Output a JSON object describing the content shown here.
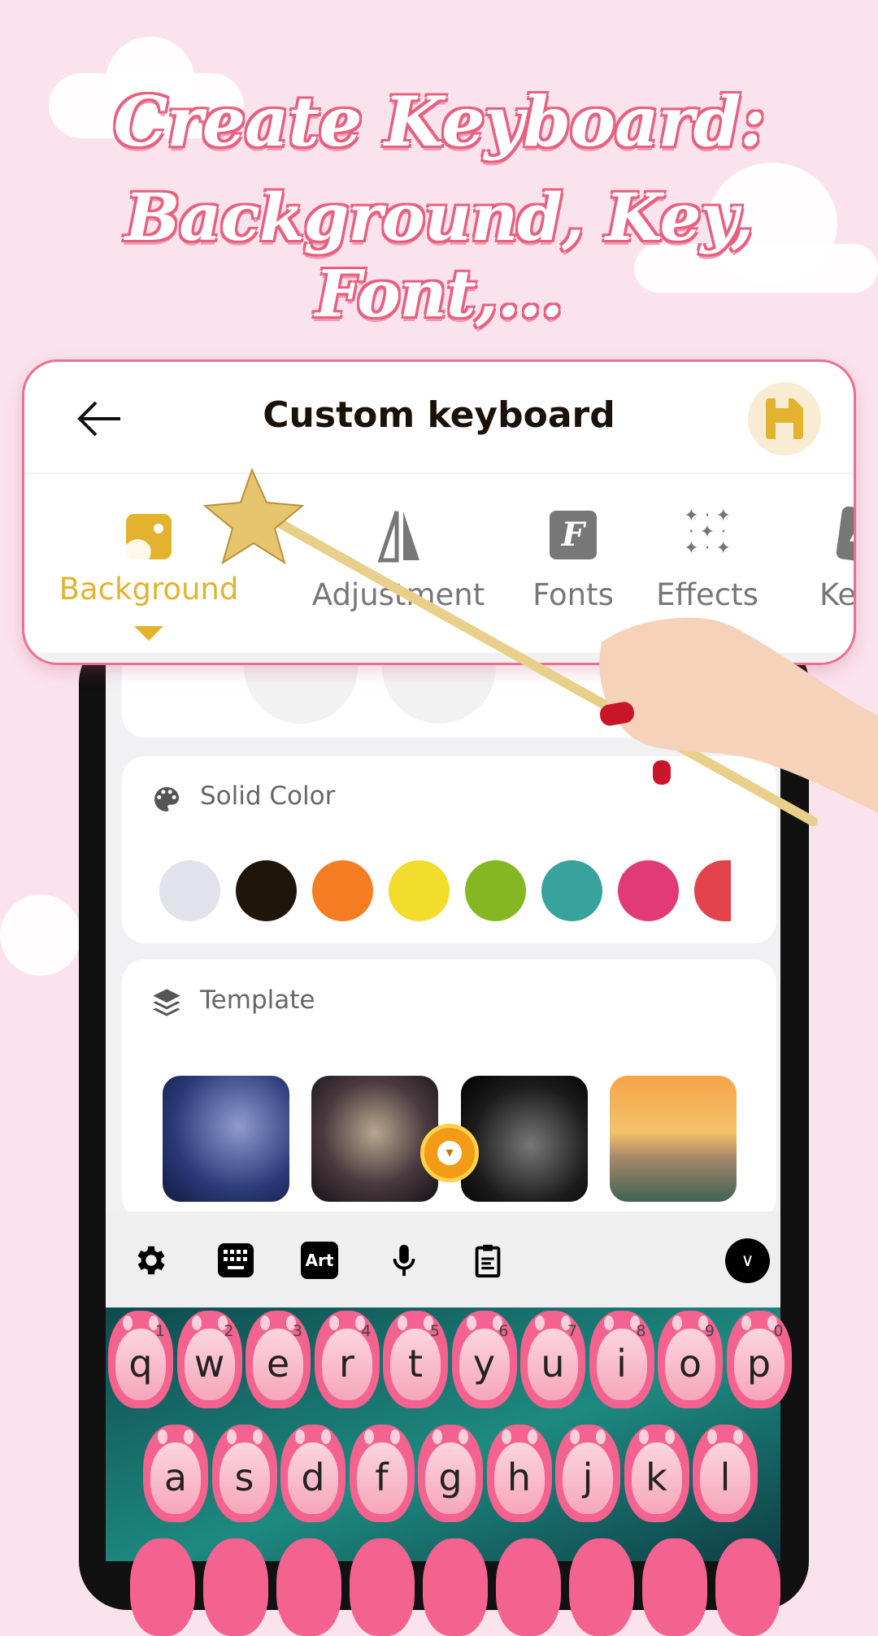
{
  "headline": {
    "line1": "Create Keyboard:",
    "line2": "Background, Key, Font,..."
  },
  "header": {
    "title": "Custom keyboard",
    "back_icon": "arrow-left-icon",
    "save_icon": "floppy-disk-icon"
  },
  "tabs": [
    {
      "label": "Background",
      "icon": "image-icon",
      "active": true
    },
    {
      "label": "Adjustment",
      "icon": "adjust-icon"
    },
    {
      "label": "Fonts",
      "icon": "font-icon"
    },
    {
      "label": "Effects",
      "icon": "sparkles-icon"
    },
    {
      "label": "Keys",
      "icon": "keys-icon"
    }
  ],
  "solid_color": {
    "title": "Solid Color",
    "colors": [
      "#e2e3ea",
      "#1f160b",
      "#f47c22",
      "#f2dc2c",
      "#83b823",
      "#37a39c",
      "#e13a77",
      "#e2434a"
    ]
  },
  "template": {
    "title": "Template"
  },
  "toolbar": {
    "art_label": "Art"
  },
  "keyboard": {
    "row1": [
      {
        "k": "q",
        "n": "1"
      },
      {
        "k": "w",
        "n": "2"
      },
      {
        "k": "e",
        "n": "3"
      },
      {
        "k": "r",
        "n": "4"
      },
      {
        "k": "t",
        "n": "5"
      },
      {
        "k": "y",
        "n": "6"
      },
      {
        "k": "u",
        "n": "7"
      },
      {
        "k": "i",
        "n": "8"
      },
      {
        "k": "o",
        "n": "9"
      },
      {
        "k": "p",
        "n": "0"
      }
    ],
    "row2": [
      "a",
      "s",
      "d",
      "f",
      "g",
      "h",
      "j",
      "k",
      "l"
    ]
  },
  "colors": {
    "accent": "#e3b22e",
    "pink_border": "#e8718f"
  }
}
